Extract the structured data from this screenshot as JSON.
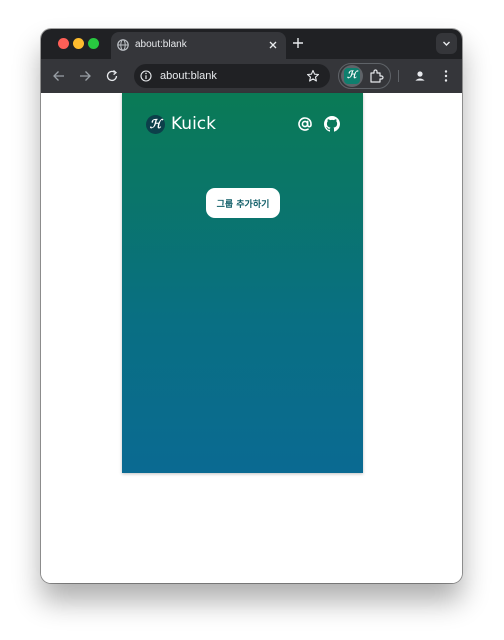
{
  "browser": {
    "tab": {
      "title": "about:blank"
    },
    "address_bar": {
      "url": "about:blank"
    }
  },
  "extension_popup": {
    "brand": {
      "logo_glyph": "ℋ",
      "name": "Kuick"
    },
    "add_group_label": "그룹 추가하기",
    "colors": {
      "gradient_top": "#0a7a55",
      "gradient_bottom": "#0a6a92",
      "button_text": "#0d5c66"
    }
  },
  "icons": [
    "globe-icon",
    "close-icon",
    "plus-icon",
    "chevron-down-icon",
    "back-arrow-icon",
    "forward-arrow-icon",
    "reload-icon",
    "info-icon",
    "star-icon",
    "puzzle-icon",
    "profile-icon",
    "kebab-menu-icon",
    "at-sign-icon",
    "github-icon"
  ]
}
